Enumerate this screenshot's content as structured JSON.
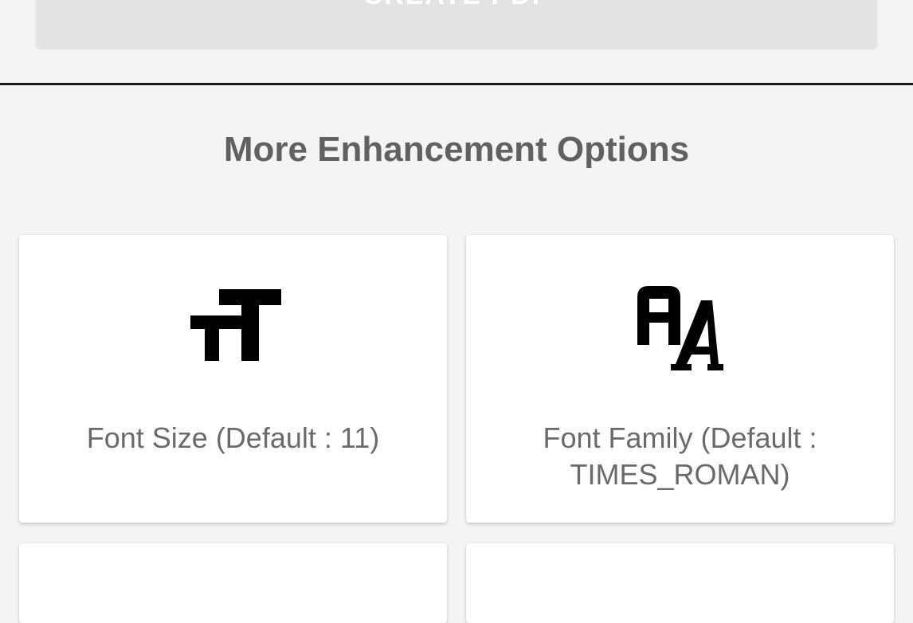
{
  "toolbar": {
    "create_pdf_label": "CREATE PDF"
  },
  "enhancements": {
    "title": "More Enhancement Options",
    "options": [
      {
        "label": "Font Size (Default : 11)",
        "icon": "font-size-icon"
      },
      {
        "label_line1": "Font Family (Default :",
        "label_line2": "TIMES_ROMAN)",
        "icon": "font-family-icon"
      }
    ]
  }
}
